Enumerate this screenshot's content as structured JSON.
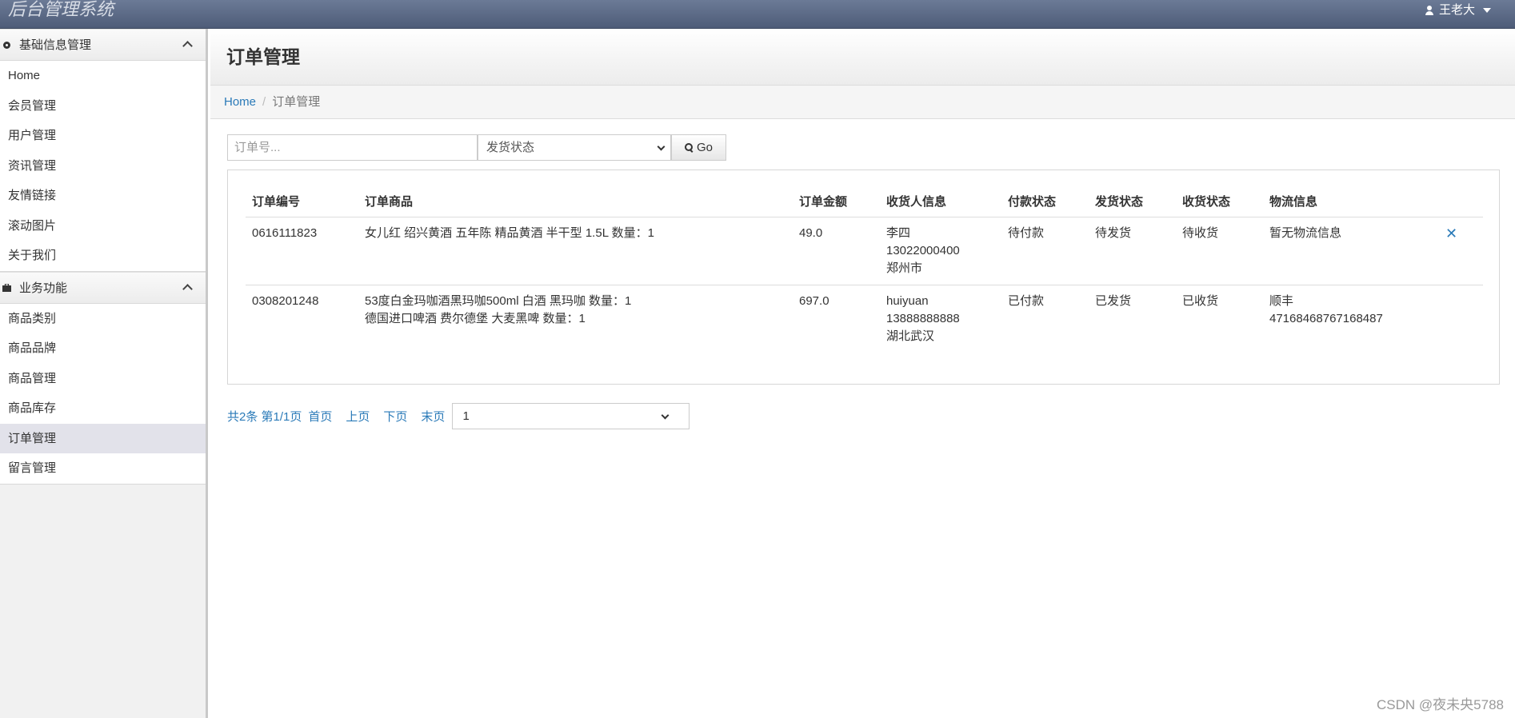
{
  "app": {
    "title": "后台管理系统",
    "user_name": "王老大"
  },
  "sidebar": {
    "groups": [
      {
        "title": "基础信息管理",
        "items": [
          "Home",
          "会员管理",
          "用户管理",
          "资讯管理",
          "友情链接",
          "滚动图片",
          "关于我们"
        ]
      },
      {
        "title": "业务功能",
        "items": [
          "商品类别",
          "商品品牌",
          "商品管理",
          "商品库存",
          "订单管理",
          "留言管理"
        ],
        "active": "订单管理"
      }
    ]
  },
  "page": {
    "title": "订单管理",
    "breadcrumb": {
      "home": "Home",
      "current": "订单管理"
    }
  },
  "filter": {
    "order_no_placeholder": "订单号...",
    "status_selected": "发货状态",
    "go_label": "Go"
  },
  "table": {
    "headers": [
      "订单编号",
      "订单商品",
      "订单金额",
      "收货人信息",
      "付款状态",
      "发货状态",
      "收货状态",
      "物流信息"
    ],
    "rows": [
      {
        "order_no": "0616111823",
        "goods": [
          "女儿红 绍兴黄酒 五年陈 精品黄酒 半干型 1.5L  数量：1"
        ],
        "amount": "49.0",
        "receiver": [
          "李四",
          "13022000400",
          "郑州市"
        ],
        "pay_status": "待付款",
        "ship_status": "待发货",
        "receive_status": "待收货",
        "logistics": [
          "暂无物流信息"
        ],
        "has_delete": true
      },
      {
        "order_no": "0308201248",
        "goods": [
          "53度白金玛咖酒黑玛咖500ml 白酒 黑玛咖  数量：1",
          "德国进口啤酒 费尔德堡 大麦黑啤  数量：1"
        ],
        "amount": "697.0",
        "receiver": [
          "huiyuan",
          "13888888888",
          "湖北武汉"
        ],
        "pay_status": "已付款",
        "ship_status": "已发货",
        "receive_status": "已收货",
        "logistics": [
          "顺丰",
          "47168468767168487"
        ],
        "has_delete": false
      }
    ]
  },
  "pager": {
    "info": "共2条  第1/1页",
    "first": "首页",
    "prev": "上页",
    "next": "下页",
    "last": "末页",
    "page_selected": "1"
  },
  "watermark": "CSDN @夜未央5788"
}
